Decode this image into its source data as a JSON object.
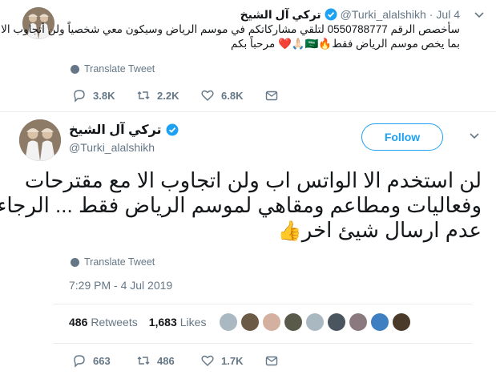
{
  "tweet1": {
    "name": "تركي آل الشيخ",
    "handle": "@Turki_alalshikh",
    "date": "Jul 4",
    "text_lines": [
      "سأخصص الرقم 0550788777 لتلقي مشاركاتكم في موسم الرياض وسيكون معي شخصياً ولن أتجاوب الا",
      "بما يخص موسم الرياض فقط🔥🇸🇦🙏🏻❤️ مرحباً بكم"
    ],
    "translate_label": "Translate Tweet",
    "replies": "3.8K",
    "retweets": "2.2K",
    "likes": "6.8K"
  },
  "tweet2": {
    "name": "تركي آل الشيخ",
    "handle": "@Turki_alalshikh",
    "follow_label": "Follow",
    "text_lines": [
      "لن استخدم الا الواتس اب ولن اتجاوب الا مع مقترحات",
      "وفعاليات ومطاعم ومقاهي لموسم الرياض فقط ... الرجاء",
      "عدم ارسال شيئ اخر"
    ],
    "thumbs": "👍",
    "translate_label": "Translate Tweet",
    "timestamp": "7:29 PM - 4 Jul 2019",
    "retweet_count": "486",
    "retweet_label": "Retweets",
    "like_count": "1,683",
    "like_label": "Likes",
    "replies": "663",
    "retweets": "486",
    "likes": "1.7K"
  },
  "colors": {
    "accent": "#1da1f2",
    "muted": "#657786",
    "divider": "#e6ecf0"
  }
}
